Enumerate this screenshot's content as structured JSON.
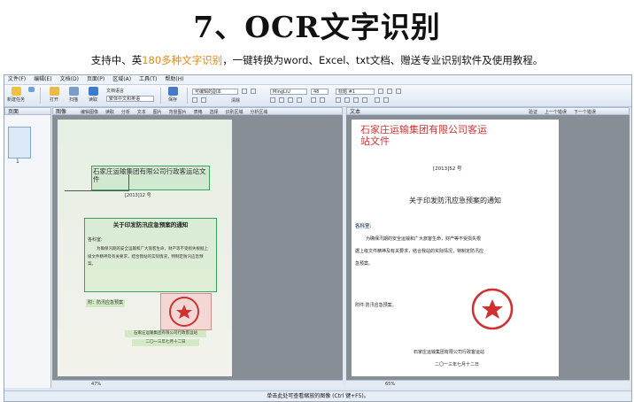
{
  "banner": {
    "title": "7、OCR文字识别",
    "subtitle_pre": "支持中、英",
    "subtitle_hl": "180多种文字识别",
    "subtitle_post": "，一键转换为word、Excel、txt文档、赠送专业识别软件及使用教程。"
  },
  "menu": [
    "文件(F)",
    "编辑(E)",
    "文档(D)",
    "页面(P)",
    "区域(A)",
    "工具(T)",
    "帮助(H)"
  ],
  "toolbar": {
    "new_label": "新建任务",
    "open_label": "打开",
    "scan_label": "扫描",
    "read_label": "读取",
    "doc_lang_label": "文档语言",
    "doc_lang_value": "繁体中文和英语",
    "save_label": "保存",
    "layout_value": "可编辑的副本",
    "font_value": "MingLiU",
    "size_value": "48",
    "style_value": "标题 #1",
    "clear_label": "清除"
  },
  "left_panel": {
    "title": "页面",
    "page_number": "1"
  },
  "image_panel": {
    "title": "图像",
    "tools": [
      "编辑图像",
      "读取",
      "分析",
      "文本",
      "图片",
      "背景图片",
      "表格",
      "选择",
      "识别区域",
      "分析区域"
    ],
    "zoom": "47%"
  },
  "text_panel": {
    "title": "文本",
    "verify_label": "验证",
    "prev_label": "上一个错误",
    "next_label": "下一个错误",
    "zoom": "65%"
  },
  "scan_doc": {
    "header": "石家庄运输集团有限公司行政客运站文件",
    "number": "[2013]12 号",
    "notice_title": "关于印发防汛应急预案的通知",
    "addressee": "各科室:",
    "body": "为确保汛期的安全运输和广大旅客生命，财产等不受损失根据上级文件精神及有关要求，结合我站的实际情况，特制定防汛应急预案。",
    "attachment": "附：防汛应急预案",
    "footer_org": "石家庄运输集团有限公司行政客运站",
    "footer_date": "二〇一三年七月十二日"
  },
  "ocr_doc": {
    "header_line1": "石家庄运输集团有限公司客运",
    "header_line2": "站文件",
    "number": "[2013]52 号",
    "notice_title": "关于印发防汛应急预案的通知",
    "addressee": "各科室:",
    "body_line1": "为确保汛期的安全运输和广大旅客生命，财产等不受损失根",
    "body_line2": "据上级文件精神及有关要求，结合我站的实际情况，特制定防汛应",
    "body_line3": "急预案。",
    "attachment": "附件:防汛应急预案。",
    "footer_org": "石家庄运输集团有限公司行政客运站",
    "footer_date": "二〇一三年七月十二日"
  },
  "status_bar": {
    "hint": "单击此处可查看缩放的图像 (Ctrl 键+F5)。"
  },
  "colors": {
    "highlight": "#e08a1a",
    "stamp": "#d03030",
    "ocr_highlight": "#bfe0ff",
    "zone_border": "#3aa35a"
  }
}
